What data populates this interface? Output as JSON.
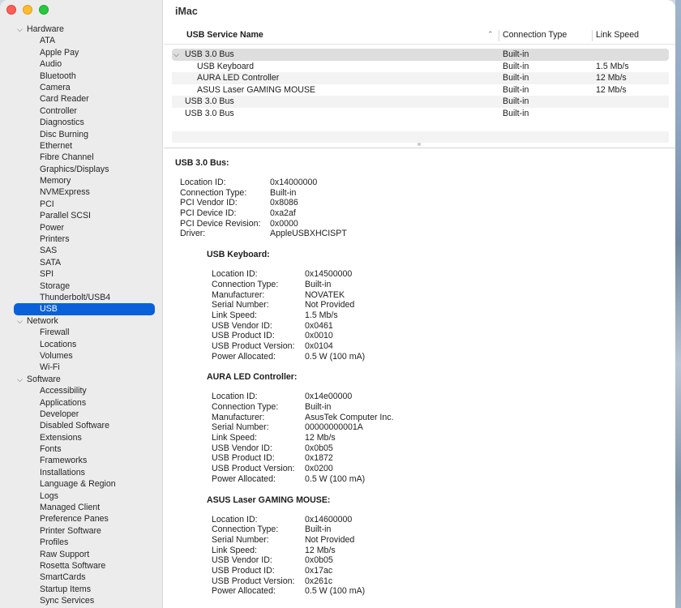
{
  "window": {
    "title": "iMac"
  },
  "sidebar": {
    "groups": [
      {
        "label": "Hardware",
        "items": [
          "ATA",
          "Apple Pay",
          "Audio",
          "Bluetooth",
          "Camera",
          "Card Reader",
          "Controller",
          "Diagnostics",
          "Disc Burning",
          "Ethernet",
          "Fibre Channel",
          "Graphics/Displays",
          "Memory",
          "NVMExpress",
          "PCI",
          "Parallel SCSI",
          "Power",
          "Printers",
          "SAS",
          "SATA",
          "SPI",
          "Storage",
          "Thunderbolt/USB4",
          "USB"
        ]
      },
      {
        "label": "Network",
        "items": [
          "Firewall",
          "Locations",
          "Volumes",
          "Wi-Fi"
        ]
      },
      {
        "label": "Software",
        "items": [
          "Accessibility",
          "Applications",
          "Developer",
          "Disabled Software",
          "Extensions",
          "Fonts",
          "Frameworks",
          "Installations",
          "Language & Region",
          "Logs",
          "Managed Client",
          "Preference Panes",
          "Printer Software",
          "Profiles",
          "Raw Support",
          "Rosetta Software",
          "SmartCards",
          "Startup Items",
          "Sync Services"
        ]
      }
    ],
    "selected": "USB"
  },
  "table": {
    "columns": {
      "name": "USB Service Name",
      "sort_icon": "chevron-up",
      "connection": "Connection Type",
      "speed": "Link Speed"
    },
    "rows": [
      {
        "name": "USB 3.0 Bus",
        "connection": "Built-in",
        "speed": "",
        "level": 0,
        "expanded": true
      },
      {
        "name": "USB Keyboard",
        "connection": "Built-in",
        "speed": "1.5 Mb/s",
        "level": 1
      },
      {
        "name": "AURA LED Controller",
        "connection": "Built-in",
        "speed": "12 Mb/s",
        "level": 1
      },
      {
        "name": "ASUS Laser GAMING MOUSE",
        "connection": "Built-in",
        "speed": "12 Mb/s",
        "level": 1
      },
      {
        "name": "USB 3.0 Bus",
        "connection": "Built-in",
        "speed": "",
        "level": 0
      },
      {
        "name": "USB 3.0 Bus",
        "connection": "Built-in",
        "speed": "",
        "level": 0
      }
    ]
  },
  "detail": {
    "bus": {
      "title": "USB 3.0 Bus:",
      "fields": [
        [
          "Location ID:",
          "0x14000000"
        ],
        [
          "Connection Type:",
          "Built-in"
        ],
        [
          "PCI Vendor ID:",
          "0x8086"
        ],
        [
          "PCI Device ID:",
          "0xa2af"
        ],
        [
          "PCI Device Revision:",
          "0x0000"
        ],
        [
          "Driver:",
          "AppleUSBXHCISPT"
        ]
      ]
    },
    "devices": [
      {
        "title": "USB Keyboard:",
        "fields": [
          [
            "Location ID:",
            "0x14500000"
          ],
          [
            "Connection Type:",
            "Built-in"
          ],
          [
            "Manufacturer:",
            "NOVATEK"
          ],
          [
            "Serial Number:",
            "Not Provided"
          ],
          [
            "Link Speed:",
            "1.5 Mb/s"
          ],
          [
            "USB Vendor ID:",
            "0x0461"
          ],
          [
            "USB Product ID:",
            "0x0010"
          ],
          [
            "USB Product Version:",
            "0x0104"
          ],
          [
            "Power Allocated:",
            "0.5 W (100 mA)"
          ]
        ]
      },
      {
        "title": "AURA LED Controller:",
        "fields": [
          [
            "Location ID:",
            "0x14e00000"
          ],
          [
            "Connection Type:",
            "Built-in"
          ],
          [
            "Manufacturer:",
            "AsusTek Computer Inc."
          ],
          [
            "Serial Number:",
            "00000000001A"
          ],
          [
            "Link Speed:",
            "12 Mb/s"
          ],
          [
            "USB Vendor ID:",
            "0x0b05"
          ],
          [
            "USB Product ID:",
            "0x1872"
          ],
          [
            "USB Product Version:",
            "0x0200"
          ],
          [
            "Power Allocated:",
            "0.5 W (100 mA)"
          ]
        ]
      },
      {
        "title": "ASUS Laser GAMING MOUSE:",
        "fields": [
          [
            "Location ID:",
            "0x14600000"
          ],
          [
            "Connection Type:",
            "Built-in"
          ],
          [
            "Serial Number:",
            "Not Provided"
          ],
          [
            "Link Speed:",
            "12 Mb/s"
          ],
          [
            "USB Vendor ID:",
            "0x0b05"
          ],
          [
            "USB Product ID:",
            "0x17ac"
          ],
          [
            "USB Product Version:",
            "0x261c"
          ],
          [
            "Power Allocated:",
            "0.5 W (100 mA)"
          ]
        ]
      }
    ]
  }
}
